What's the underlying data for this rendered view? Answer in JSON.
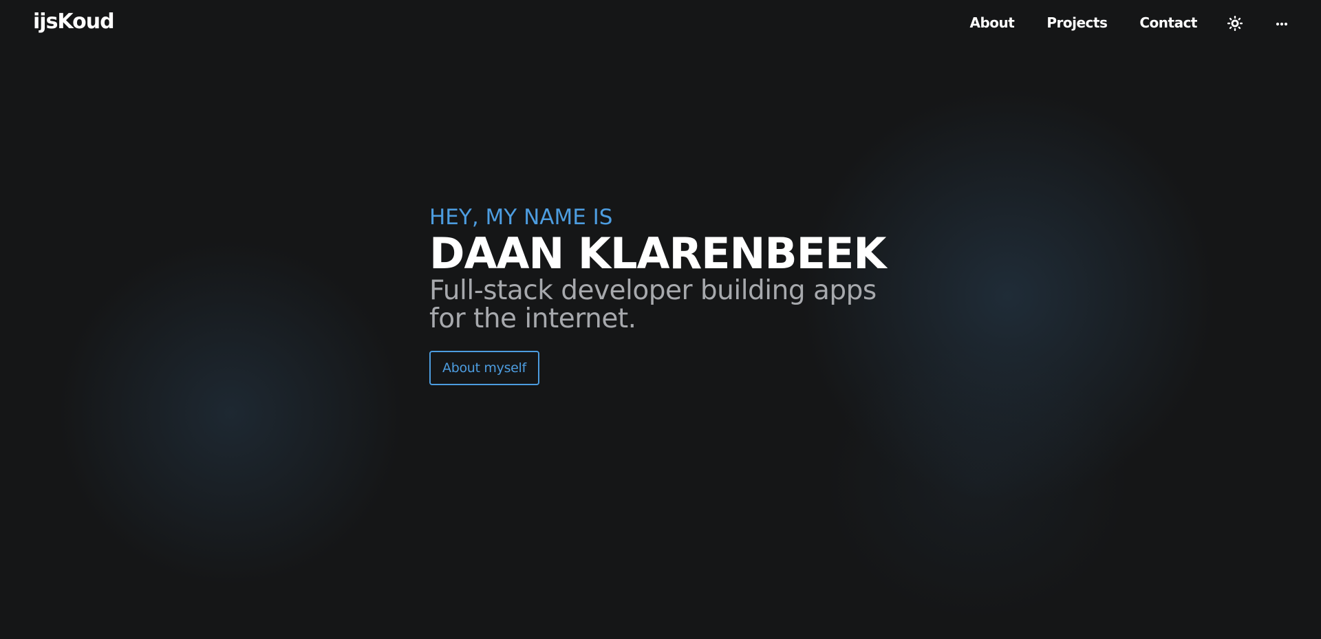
{
  "nav": {
    "brand": "ijsKoud",
    "links": [
      {
        "label": "About"
      },
      {
        "label": "Projects"
      },
      {
        "label": "Contact"
      }
    ],
    "theme_icon": "sun-icon",
    "more_icon": "ellipsis-icon"
  },
  "hero": {
    "greeting": "HEY, MY NAME IS",
    "name": "DAAN KLARENBEEK",
    "tagline": "Full-stack developer building apps for the internet.",
    "cta_label": "About myself"
  },
  "colors": {
    "background": "#151617",
    "accent": "#4d9de0",
    "text": "#ffffff",
    "muted": "#a7a9ad"
  }
}
